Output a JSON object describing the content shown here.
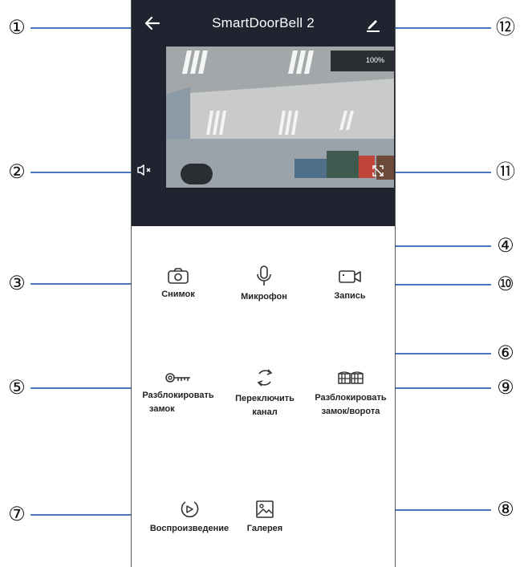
{
  "header": {
    "title": "SmartDoorBell 2"
  },
  "video": {
    "zoom_label": "100%"
  },
  "controls": {
    "snapshot": "Снимок",
    "microphone": "Микрофон",
    "record": "Запись",
    "unlock_lock_1": "Разблокировать",
    "unlock_lock_2": "замок",
    "switch_channel_1": "Переключить",
    "switch_channel_2": "канал",
    "unlock_gate_1": "Разблокировать",
    "unlock_gate_2": "замок/ворота",
    "playback": "Воспроизведение",
    "gallery": "Галерея"
  },
  "callouts": [
    "①",
    "②",
    "③",
    "④",
    "⑤",
    "⑥",
    "⑦",
    "⑧",
    "⑨",
    "⑩",
    "⑪",
    "⑫"
  ],
  "colors": {
    "header_bg": "#1f2430",
    "callout_line": "#4a76c0",
    "text": "#222222"
  },
  "icons": [
    "back-arrow-icon",
    "edit-icon",
    "speaker-mute-icon",
    "fullscreen-icon",
    "camera-icon",
    "microphone-icon",
    "video-camera-icon",
    "key-icon",
    "switch-channel-icon",
    "gate-icon",
    "playback-icon",
    "gallery-icon"
  ]
}
